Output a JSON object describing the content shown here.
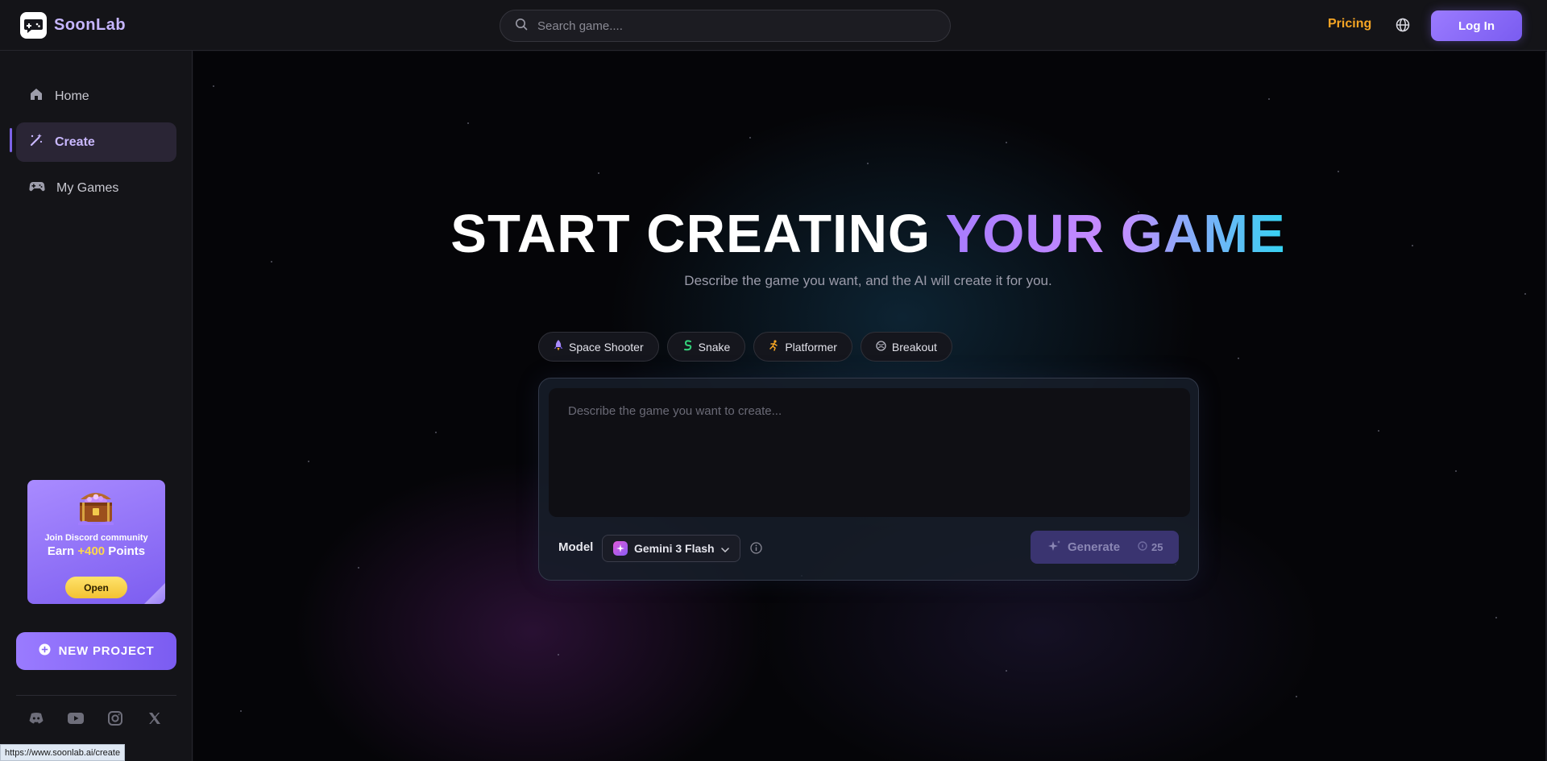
{
  "brand": {
    "name": "SoonLab",
    "logo_icon": "gamepad-chat-icon"
  },
  "header": {
    "search_placeholder": "Search game....",
    "pricing_label": "Pricing",
    "login_label": "Log In",
    "globe_icon": "globe-icon"
  },
  "sidebar": {
    "items": [
      {
        "label": "Home",
        "icon": "home-icon",
        "active": false
      },
      {
        "label": "Create",
        "icon": "magic-wand-icon",
        "active": true
      },
      {
        "label": "My Games",
        "icon": "gamepad-icon",
        "active": false
      }
    ],
    "promo": {
      "line1": "Join Discord community",
      "line2_prefix": "Earn ",
      "line2_highlight": "+400",
      "line2_suffix": " Points",
      "button_label": "Open"
    },
    "new_project_label": "NEW PROJECT",
    "socials": [
      "discord-icon",
      "youtube-icon",
      "instagram-icon",
      "x-icon"
    ]
  },
  "hero": {
    "title_plain": "START CREATING ",
    "title_gradient": "YOUR GAME",
    "subtitle": "Describe the game you want, and the AI will create it for you."
  },
  "templates": [
    {
      "label": "Space Shooter",
      "icon": "rocket-icon"
    },
    {
      "label": "Snake",
      "icon": "snake-icon"
    },
    {
      "label": "Platformer",
      "icon": "runner-icon"
    },
    {
      "label": "Breakout",
      "icon": "ball-icon"
    }
  ],
  "composer": {
    "prompt_placeholder": "Describe the game you want to create...",
    "model_label": "Model",
    "model_value": "Gemini 3 Flash",
    "generate_label": "Generate",
    "generate_cost": "25"
  },
  "status_bar_url": "https://www.soonlab.ai/create",
  "colors": {
    "accent": "#8b6cf6",
    "pricing": "#f5a524",
    "gradient_start": "#a77bff",
    "gradient_end": "#34d3f2"
  }
}
